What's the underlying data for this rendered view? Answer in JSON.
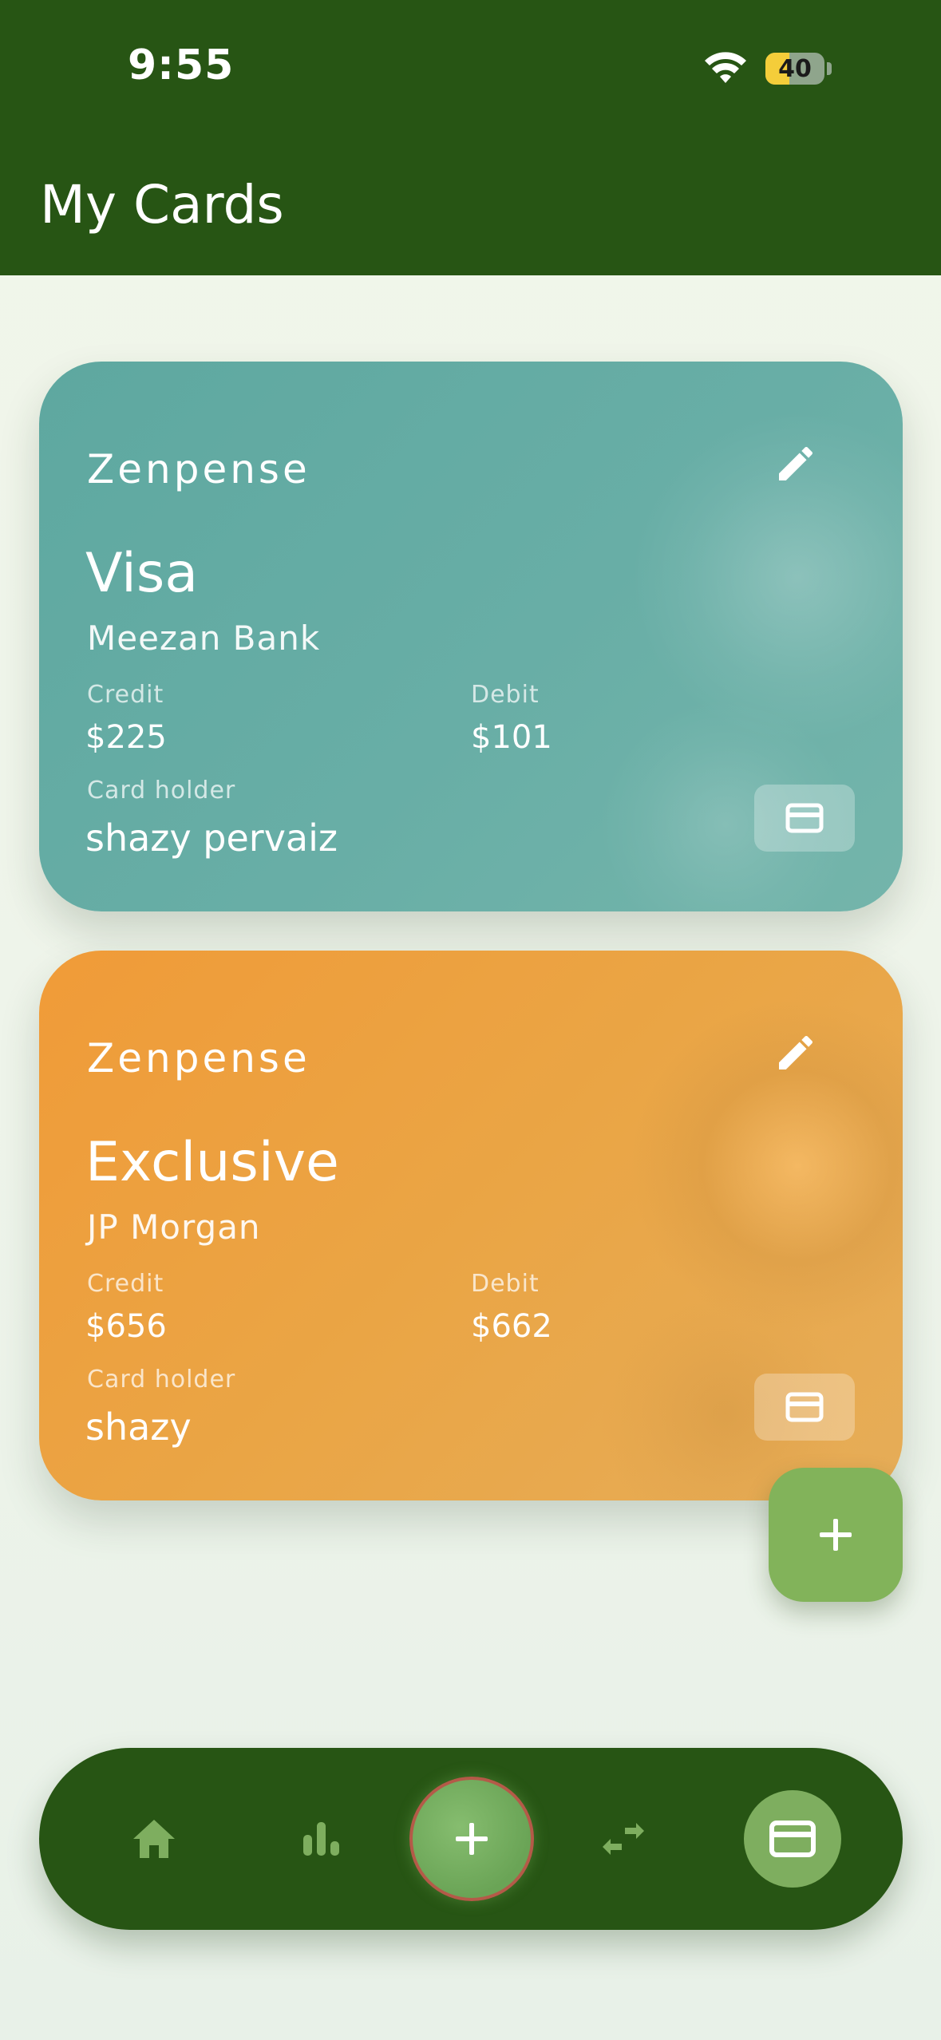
{
  "status_bar": {
    "time": "9:55",
    "battery_level": "40",
    "icons": [
      "wifi-icon",
      "battery-icon"
    ]
  },
  "header": {
    "title": "My Cards",
    "background_color": "#275514"
  },
  "cards": [
    {
      "brand": "Zenpense",
      "type": "Visa",
      "bank": "Meezan Bank",
      "credit_label": "Credit",
      "credit_value": "$225",
      "debit_label": "Debit",
      "debit_value": "$101",
      "holder_label": "Card holder",
      "holder_name": "shazy pervaiz",
      "color": "#63aba3",
      "icons": [
        "edit-icon",
        "credit-card-icon"
      ]
    },
    {
      "brand": "Zenpense",
      "type": "Exclusive",
      "bank": "JP Morgan",
      "credit_label": "Credit",
      "credit_value": "$656",
      "debit_label": "Debit",
      "debit_value": "$662",
      "holder_label": "Card holder",
      "holder_name": "shazy",
      "color": "#eaa545",
      "icons": [
        "edit-icon",
        "credit-card-icon"
      ]
    }
  ],
  "fab": {
    "icon": "plus-icon",
    "color": "#82b35a"
  },
  "bottom_nav": {
    "items": [
      {
        "icon": "home-icon",
        "active": false
      },
      {
        "icon": "bar-chart-icon",
        "active": false
      },
      {
        "icon": "plus-icon",
        "active": false
      },
      {
        "icon": "transfer-icon",
        "active": false
      },
      {
        "icon": "credit-card-icon",
        "active": true
      }
    ],
    "background_color": "#275514",
    "accent_color": "#7eae5f"
  }
}
